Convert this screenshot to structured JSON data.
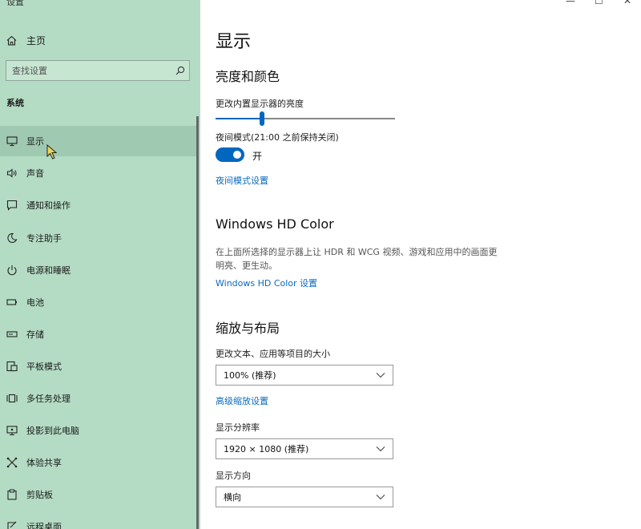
{
  "window": {
    "title": "设置",
    "controls": {
      "minimize": "—",
      "maximize": "☐",
      "close": "✕"
    }
  },
  "sidebar": {
    "home_label": "主页",
    "search_placeholder": "查找设置",
    "section": "系统",
    "items": [
      {
        "label": "显示",
        "icon": "monitor-icon",
        "selected": true
      },
      {
        "label": "声音",
        "icon": "speaker-icon"
      },
      {
        "label": "通知和操作",
        "icon": "notification-icon"
      },
      {
        "label": "专注助手",
        "icon": "moon-icon"
      },
      {
        "label": "电源和睡眠",
        "icon": "power-icon"
      },
      {
        "label": "电池",
        "icon": "battery-icon"
      },
      {
        "label": "存储",
        "icon": "storage-icon"
      },
      {
        "label": "平板模式",
        "icon": "tablet-icon"
      },
      {
        "label": "多任务处理",
        "icon": "multitask-icon"
      },
      {
        "label": "投影到此电脑",
        "icon": "project-icon"
      },
      {
        "label": "体验共享",
        "icon": "share-icon"
      },
      {
        "label": "剪贴板",
        "icon": "clipboard-icon"
      },
      {
        "label": "远程桌面",
        "icon": "remote-desktop-icon"
      }
    ]
  },
  "main": {
    "title": "显示",
    "brightness": {
      "heading": "亮度和颜色",
      "slider_label": "更改内置显示器的亮度",
      "brightness_level": 0.26,
      "night_light_label": "夜间模式(21:00 之前保持关闭)",
      "toggle_state": "开",
      "night_light_link": "夜间模式设置"
    },
    "hdr": {
      "heading": "Windows HD Color",
      "description": "在上面所选择的显示器上让 HDR 和 WCG 视频、游戏和应用中的画面更明亮、更生动。",
      "link": "Windows HD Color 设置"
    },
    "layout": {
      "heading": "缩放与布局",
      "scale_label": "更改文本、应用等项目的大小",
      "scale_value": "100% (推荐)",
      "advanced_link": "高级缩放设置",
      "resolution_label": "显示分辨率",
      "resolution_value": "1920 × 1080 (推荐)",
      "orientation_label": "显示方向",
      "orientation_value": "横向"
    }
  },
  "colors": {
    "sidebar_bg": "#b4dcc4",
    "accent": "#0067c0",
    "link": "#0b6abf"
  }
}
